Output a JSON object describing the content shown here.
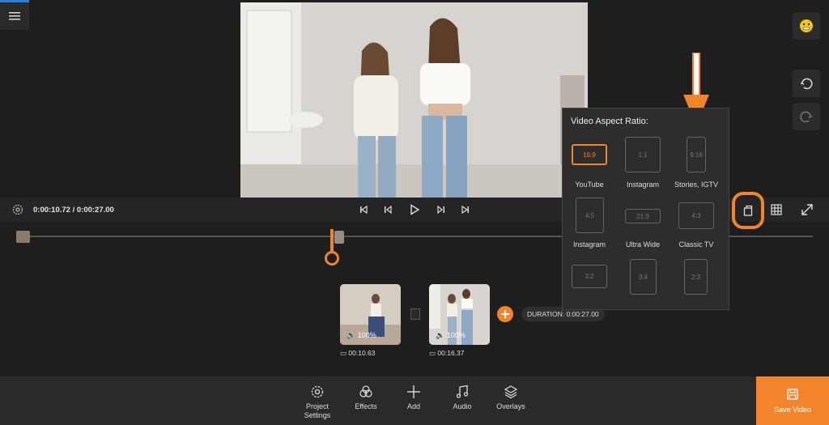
{
  "player": {
    "timecode": "0:00:10.72 / 0:00:27.00"
  },
  "aspect_popup": {
    "title": "Video Aspect Ratio:",
    "options": [
      {
        "ratio": "16:9",
        "label": "YouTube",
        "selected": true
      },
      {
        "ratio": "1:1",
        "label": "Instagram",
        "selected": false
      },
      {
        "ratio": "9:16",
        "label": "Stories, IGTV",
        "selected": false
      },
      {
        "ratio": "4:5",
        "label": "Instagram",
        "selected": false
      },
      {
        "ratio": "21:9",
        "label": "Ultra Wide",
        "selected": false
      },
      {
        "ratio": "4:3",
        "label": "Classic TV",
        "selected": false
      },
      {
        "ratio": "3:2",
        "label": "",
        "selected": false
      },
      {
        "ratio": "3:4",
        "label": "",
        "selected": false
      },
      {
        "ratio": "2:3",
        "label": "",
        "selected": false
      }
    ]
  },
  "clips": [
    {
      "volume": "100%",
      "duration": "00:10.63"
    },
    {
      "volume": "100%",
      "duration": "00:16.37"
    }
  ],
  "duration": {
    "label": "DURATION: 0:00:27.00"
  },
  "bottom_bar": {
    "project_settings": "Project Settings",
    "effects": "Effects",
    "add": "Add",
    "audio": "Audio",
    "overlays": "Overlays",
    "save_video": "Save Video"
  },
  "colors": {
    "accent": "#f2852c",
    "background": "#1e1e1e",
    "panel": "#2d2d2d"
  }
}
